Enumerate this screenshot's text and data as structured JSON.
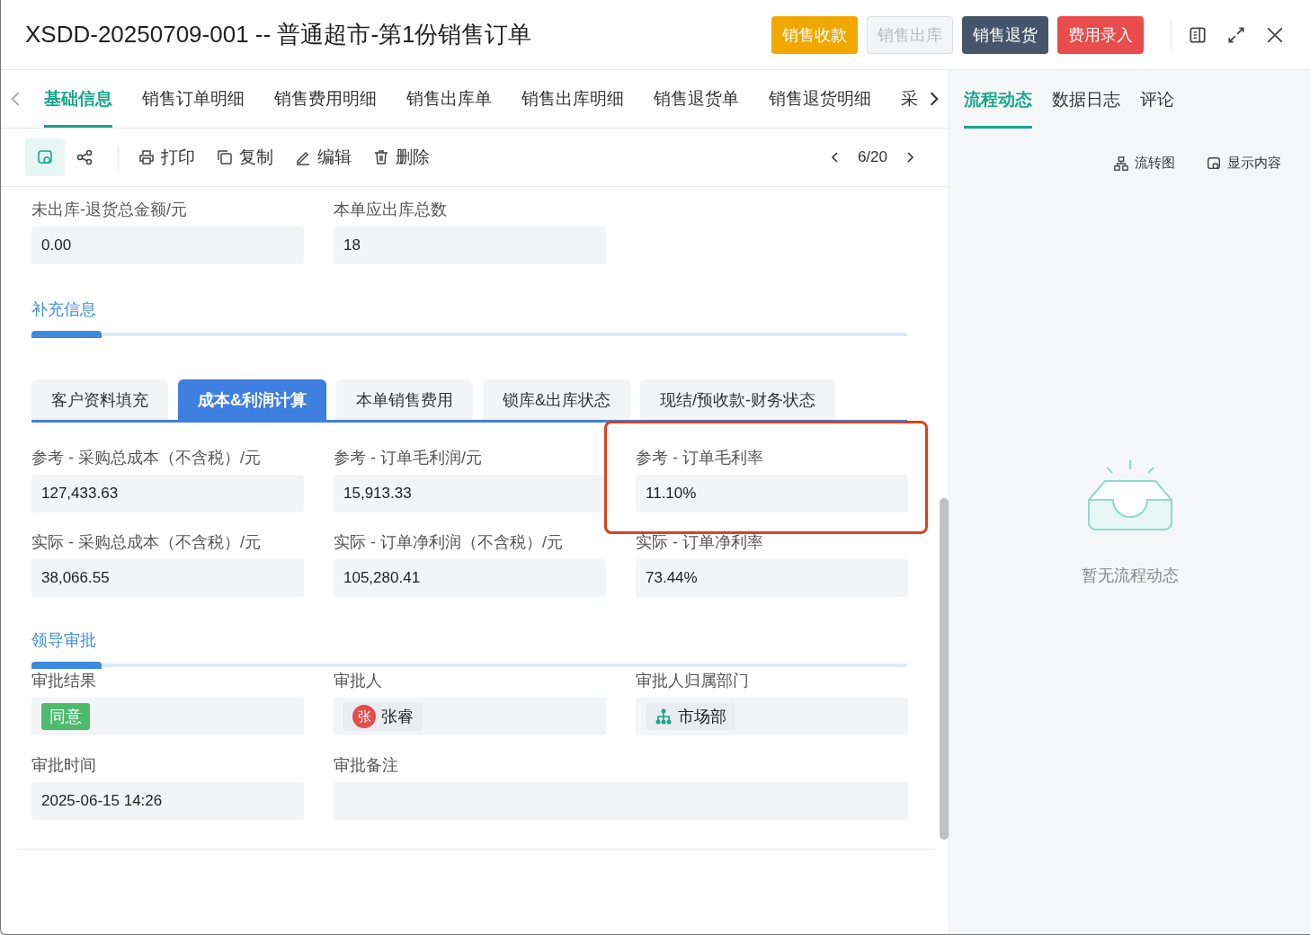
{
  "window": {
    "title": "XSDD-20250709-001 -- 普通超市-第1份销售订单"
  },
  "header_buttons": [
    {
      "label": "销售收款",
      "kind": "warning"
    },
    {
      "label": "销售出库",
      "kind": "disabled"
    },
    {
      "label": "销售退货",
      "kind": "dark"
    },
    {
      "label": "费用录入",
      "kind": "danger"
    }
  ],
  "tabs": [
    {
      "label": "基础信息",
      "selected": true
    },
    {
      "label": "销售订单明细",
      "selected": false
    },
    {
      "label": "销售费用明细",
      "selected": false
    },
    {
      "label": "销售出库单",
      "selected": false
    },
    {
      "label": "销售出库明细",
      "selected": false
    },
    {
      "label": "销售退货单",
      "selected": false
    },
    {
      "label": "销售退货明细",
      "selected": false
    },
    {
      "label": "采",
      "selected": false
    }
  ],
  "toolbar": {
    "view_selected": true,
    "actions": [
      {
        "label": "打印",
        "kind": "print"
      },
      {
        "label": "复制",
        "kind": "copy"
      },
      {
        "label": "编辑",
        "kind": "edit"
      },
      {
        "label": "删除",
        "kind": "delete"
      }
    ],
    "pager": "6/20"
  },
  "top_fields": [
    {
      "label": "未出库-退货总金额/元",
      "value": "0.00"
    },
    {
      "label": "本单应出库总数",
      "value": "18"
    }
  ],
  "sections": [
    {
      "title": "补充信息",
      "subtabs": [
        {
          "label": "客户资料填充",
          "selected": false
        },
        {
          "label": "成本&利润计算",
          "selected": true
        },
        {
          "label": "本单销售费用",
          "selected": false
        },
        {
          "label": "锁库&出库状态",
          "selected": false
        },
        {
          "label": "现结/预收款-财务状态",
          "selected": false
        }
      ],
      "fields": [
        {
          "label": "参考 - 采购总成本（不含税）/元",
          "kind": "text",
          "value": "127,433.63"
        },
        {
          "label": "参考 - 订单毛利润/元",
          "kind": "text",
          "value": "15,913.33"
        },
        {
          "label": "参考 - 订单毛利率",
          "kind": "text",
          "value": "11.10%",
          "highlighted": true
        },
        {
          "label": "实际 - 采购总成本（不含税）/元",
          "kind": "text",
          "value": "38,066.55"
        },
        {
          "label": "实际 - 订单净利润（不含税）/元",
          "kind": "text",
          "value": "105,280.41"
        },
        {
          "label": "实际 - 订单净利率",
          "kind": "text",
          "value": "73.44%"
        }
      ]
    },
    {
      "title": "领导审批",
      "fields": [
        {
          "label": "审批结果",
          "kind": "tag",
          "value": "同意"
        },
        {
          "label": "审批人",
          "kind": "person",
          "avatar": "张",
          "value": "张睿"
        },
        {
          "label": "审批人归属部门",
          "kind": "dept",
          "value": "市场部"
        },
        {
          "label": "审批时间",
          "kind": "text",
          "value": "2025-06-15 14:26"
        },
        {
          "label": "审批备注",
          "kind": "wide"
        }
      ]
    }
  ],
  "side_tabs": [
    {
      "label": "流程动态",
      "selected": true
    },
    {
      "label": "数据日志",
      "selected": false
    },
    {
      "label": "评论",
      "selected": false
    }
  ],
  "side_actions": [
    {
      "label": "流转图",
      "kind": "flow"
    },
    {
      "label": "显示内容",
      "kind": "view"
    }
  ],
  "empty_text": "暂无流程动态"
}
